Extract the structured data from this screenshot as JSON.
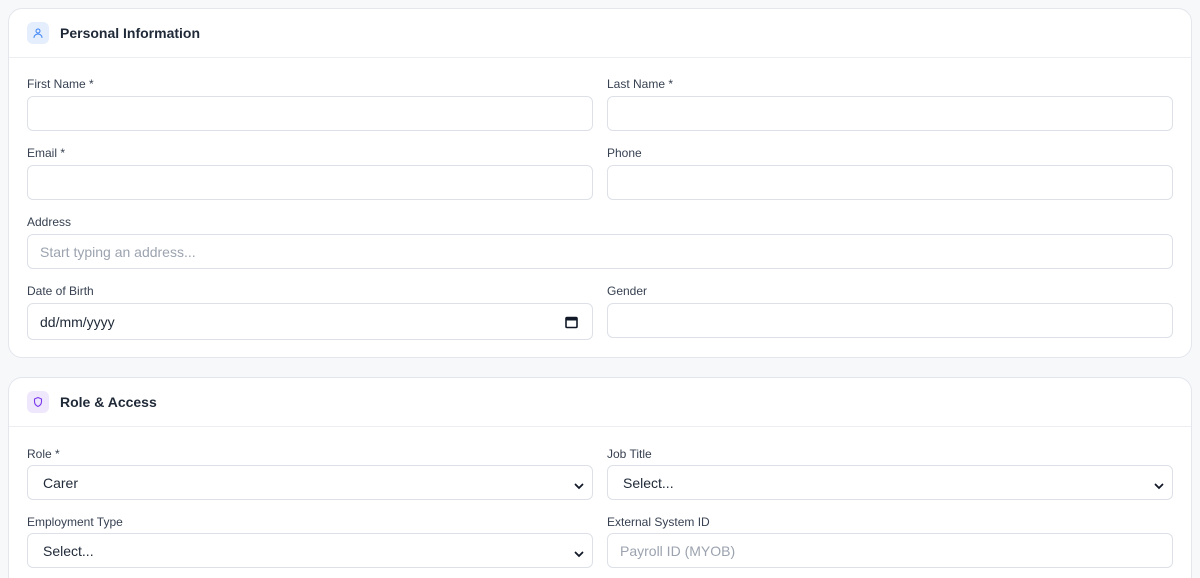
{
  "personal": {
    "title": "Personal Information",
    "icon": "user-icon",
    "first_name": {
      "label": "First Name *",
      "value": ""
    },
    "last_name": {
      "label": "Last Name *",
      "value": ""
    },
    "email": {
      "label": "Email *",
      "value": ""
    },
    "phone": {
      "label": "Phone",
      "value": ""
    },
    "address": {
      "label": "Address",
      "placeholder": "Start typing an address..."
    },
    "dob": {
      "label": "Date of Birth",
      "value": "dd/mm/yyyy"
    },
    "gender": {
      "label": "Gender",
      "value": ""
    }
  },
  "role_access": {
    "title": "Role & Access",
    "icon": "shield-icon",
    "role": {
      "label": "Role *",
      "value": "Carer"
    },
    "job_title": {
      "label": "Job Title",
      "value": "Select..."
    },
    "employment_type": {
      "label": "Employment Type",
      "value": "Select..."
    },
    "external_id": {
      "label": "External System ID",
      "placeholder": "Payroll ID (MYOB)"
    }
  },
  "colors": {
    "accent_blue": "#3b82f6",
    "accent_purple": "#7c3aed"
  }
}
